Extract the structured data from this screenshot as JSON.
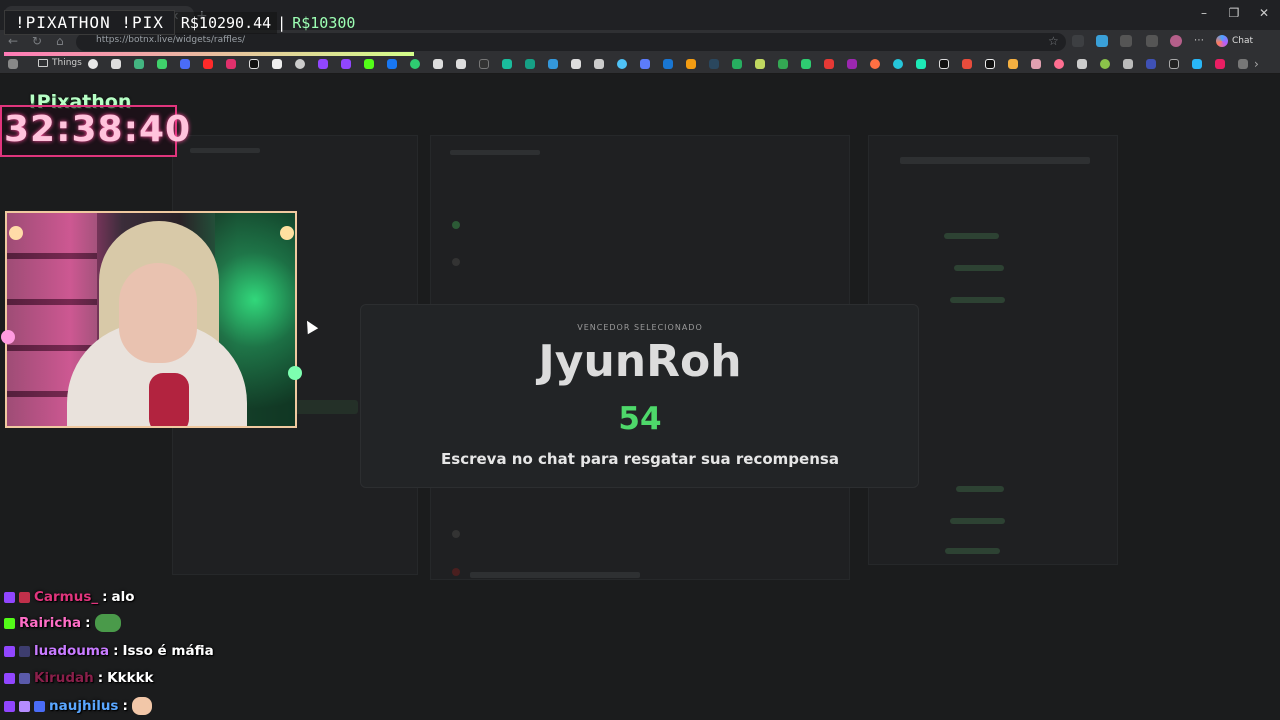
{
  "overlay": {
    "command": "!PIXATHON !PIX",
    "goal_current": "R$10290.44",
    "separator": "|",
    "goal_target": "R$10300",
    "goal_progress": 0.9991,
    "timer_title": "!Pixathon",
    "timer_value": "32:38:40"
  },
  "browser": {
    "url": "https://botnx.live/widgets/raffles/",
    "bookmark_folder": "Things",
    "chat_button": "Chat"
  },
  "modal": {
    "label": "VENCEDOR SELECIONADO",
    "winner": "JyunRoh",
    "number": "54",
    "message": "Escreva no chat para resgatar sua recompensa"
  },
  "chat": {
    "lines": [
      {
        "user": "Carmus_",
        "separator": ":",
        "message": "alo",
        "user_color": "#e0357d"
      },
      {
        "user": "Rairicha",
        "separator": ":",
        "message": "",
        "user_color": "#ff6ec7",
        "emote": "pepe-emote"
      },
      {
        "user": "luadouma",
        "separator": ":",
        "message": "Isso é máfia",
        "user_color": "#c87bff"
      },
      {
        "user": "Kirudah",
        "separator": ":",
        "message": "Kkkkk",
        "user_color": "#8a1f4a"
      },
      {
        "user": "naujhilus",
        "separator": ":",
        "message": "",
        "user_color": "#5aa7ff",
        "emote": "hamster-emote"
      }
    ]
  },
  "colors": {
    "accent_pink": "#e0357d",
    "accent_green": "#4ed86a",
    "timer_text": "#ffc3dc",
    "target_green": "#9dffb4"
  }
}
